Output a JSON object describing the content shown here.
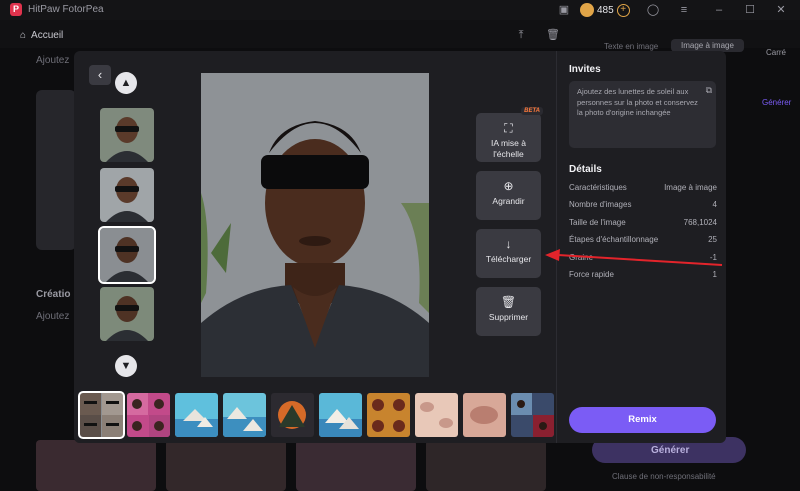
{
  "app": {
    "title": "HitPaw FotorPea",
    "credits": "485"
  },
  "background": {
    "home": "Accueil",
    "tabs": [
      "Texte en image",
      "Image à image"
    ],
    "right_sidebar": [
      "Carré",
      "Générer"
    ],
    "creation_label": "Créatio",
    "add_label": "Ajoutez",
    "add_label_top": "Ajoutez",
    "generate_button": "Générer",
    "disclaimer": "Clause de non-responsabilité"
  },
  "tools": {
    "upscale": "IA mise à l'échelle",
    "beta": "BETA",
    "enlarge": "Agrandir",
    "download": "Télécharger",
    "delete": "Supprimer"
  },
  "invites": {
    "title": "Invites",
    "prompt": "Ajoutez des lunettes de soleil aux personnes sur la photo et conservez la photo d'origine inchangée"
  },
  "details": {
    "title": "Détails",
    "rows": [
      {
        "label": "Caractéristiques",
        "value": "Image à image"
      },
      {
        "label": "Nombre d'images",
        "value": "4"
      },
      {
        "label": "Taille de l'image",
        "value": "768,1024"
      },
      {
        "label": "Étapes d'échantillonnage",
        "value": "25"
      },
      {
        "label": "Graine",
        "value": "-1"
      },
      {
        "label": "Force rapide",
        "value": "1"
      }
    ]
  },
  "remix_label": "Remix",
  "colors": {
    "accent": "#7b5cf5",
    "annotation_arrow": "#e3242b",
    "credits": "#e1a548"
  },
  "icons": [
    "logo-icon",
    "home-icon",
    "upload-icon",
    "trash-icon",
    "chevron-left-icon",
    "chevron-up-icon",
    "chevron-down-icon",
    "upscale-icon",
    "zoom-icon",
    "download-icon",
    "copy-icon"
  ]
}
